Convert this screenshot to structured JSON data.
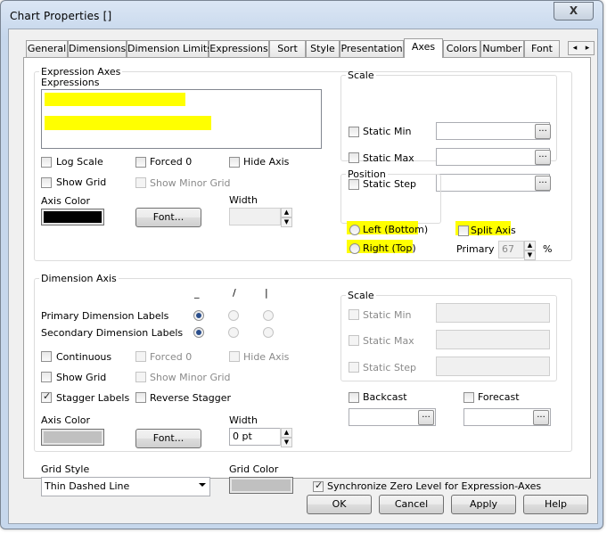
{
  "window": {
    "title": "Chart Properties []",
    "close_label": "X"
  },
  "tabs": [
    {
      "label": "General"
    },
    {
      "label": "Dimensions"
    },
    {
      "label": "Dimension Limits"
    },
    {
      "label": "Expressions"
    },
    {
      "label": "Sort"
    },
    {
      "label": "Style"
    },
    {
      "label": "Presentation"
    },
    {
      "label": "Axes"
    },
    {
      "label": "Colors"
    },
    {
      "label": "Number"
    },
    {
      "label": "Font"
    }
  ],
  "active_tab": "Axes",
  "tab_scroll": {
    "left": "◂",
    "right": "▸"
  },
  "expression_axes": {
    "legend": "Expression Axes",
    "expressions_label": "Expressions",
    "log_scale": {
      "label": "Log Scale",
      "checked": false
    },
    "forced_0": {
      "label": "Forced 0",
      "checked": false
    },
    "hide_axis": {
      "label": "Hide Axis",
      "checked": false
    },
    "show_grid": {
      "label": "Show Grid",
      "checked": false
    },
    "show_minor_grid": {
      "label": "Show Minor Grid",
      "checked": false
    },
    "axis_color_label": "Axis Color",
    "axis_color": "#000000",
    "font_button": "Font...",
    "width_label": "Width",
    "width_value": "",
    "scale": {
      "legend": "Scale",
      "static_min": "Static Min",
      "static_max": "Static Max",
      "static_step": "Static Step",
      "dots": "..."
    },
    "position": {
      "legend": "Position",
      "left_bottom": "Left (Bottom)",
      "right_top": "Right (Top)"
    },
    "split_axis": {
      "label": "Split Axis",
      "checked": false
    },
    "primary_label": "Primary",
    "primary_value": "67",
    "percent": "%"
  },
  "dimension_axis": {
    "legend": "Dimension Axis",
    "col_headers": [
      "_",
      "/",
      "|"
    ],
    "primary_labels": "Primary Dimension Labels",
    "secondary_labels": "Secondary Dimension Labels",
    "continuous": {
      "label": "Continuous",
      "checked": false
    },
    "forced_0": {
      "label": "Forced 0",
      "checked": false
    },
    "hide_axis": {
      "label": "Hide Axis",
      "checked": false
    },
    "show_grid": {
      "label": "Show Grid",
      "checked": false
    },
    "show_minor_grid": {
      "label": "Show Minor Grid",
      "checked": false
    },
    "stagger_labels": {
      "label": "Stagger Labels",
      "checked": true
    },
    "reverse_stagger": {
      "label": "Reverse Stagger",
      "checked": false
    },
    "axis_color_label": "Axis Color",
    "axis_color": "#c0c0c0",
    "font_button": "Font...",
    "width_label": "Width",
    "width_value": "0 pt",
    "scale": {
      "legend": "Scale",
      "static_min": "Static Min",
      "static_max": "Static Max",
      "static_step": "Static Step"
    },
    "backcast": {
      "label": "Backcast",
      "checked": false
    },
    "forecast": {
      "label": "Forecast",
      "checked": false
    },
    "dots": "..."
  },
  "grid": {
    "style_label": "Grid Style",
    "style_value": "Thin Dashed Line",
    "color_label": "Grid Color",
    "color": "#c0c0c0",
    "sync_zero": {
      "label": "Synchronize Zero Level for Expression-Axes",
      "checked": true
    }
  },
  "buttons": {
    "ok": "OK",
    "cancel": "Cancel",
    "apply": "Apply",
    "help": "Help"
  },
  "colors": {
    "highlight": "#ffff00"
  }
}
